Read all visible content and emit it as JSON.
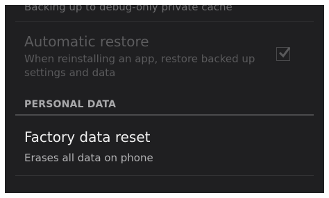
{
  "backup": {
    "summary": "Backing up to debug-only private cache"
  },
  "automatic_restore": {
    "title": "Automatic restore",
    "summary": "When reinstalling an app, restore backed up settings and data",
    "checked": true
  },
  "personal_data": {
    "header": "PERSONAL DATA"
  },
  "factory_reset": {
    "title": "Factory data reset",
    "summary": "Erases all data on phone"
  }
}
